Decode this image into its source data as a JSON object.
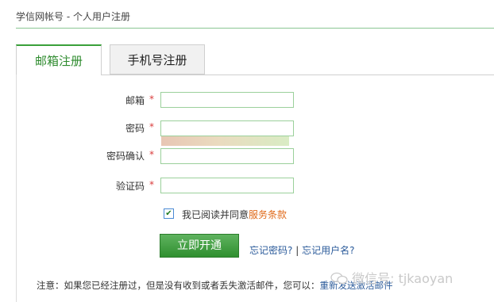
{
  "header": {
    "title": "学信网帐号 - 个人用户注册"
  },
  "tabs": [
    {
      "label": "邮箱注册",
      "active": true
    },
    {
      "label": "手机号注册",
      "active": false
    }
  ],
  "form": {
    "email_label": "邮箱",
    "password_label": "密码",
    "confirm_label": "密码确认",
    "captcha_label": "验证码",
    "required_mark": "*",
    "email_value": "",
    "password_value": "",
    "confirm_value": "",
    "captcha_value": ""
  },
  "agreement": {
    "checked": true,
    "text": "我已阅读并同意",
    "link": "服务条款"
  },
  "submit_label": "立即开通",
  "links": {
    "forgot_password": "忘记密码?",
    "separator": "|",
    "forgot_username": "忘记用户名?"
  },
  "note": {
    "text": "注意：如果您已经注册过，但是没有收到或者丢失激活邮件，您可以：",
    "link": "重新发送激活邮件"
  },
  "watermark": "微信号: tjkaoyan",
  "colors": {
    "accent_green": "#3aa03a",
    "required_red": "#d93b3b",
    "link_blue": "#2a5a9a",
    "link_orange": "#e06a1a"
  }
}
